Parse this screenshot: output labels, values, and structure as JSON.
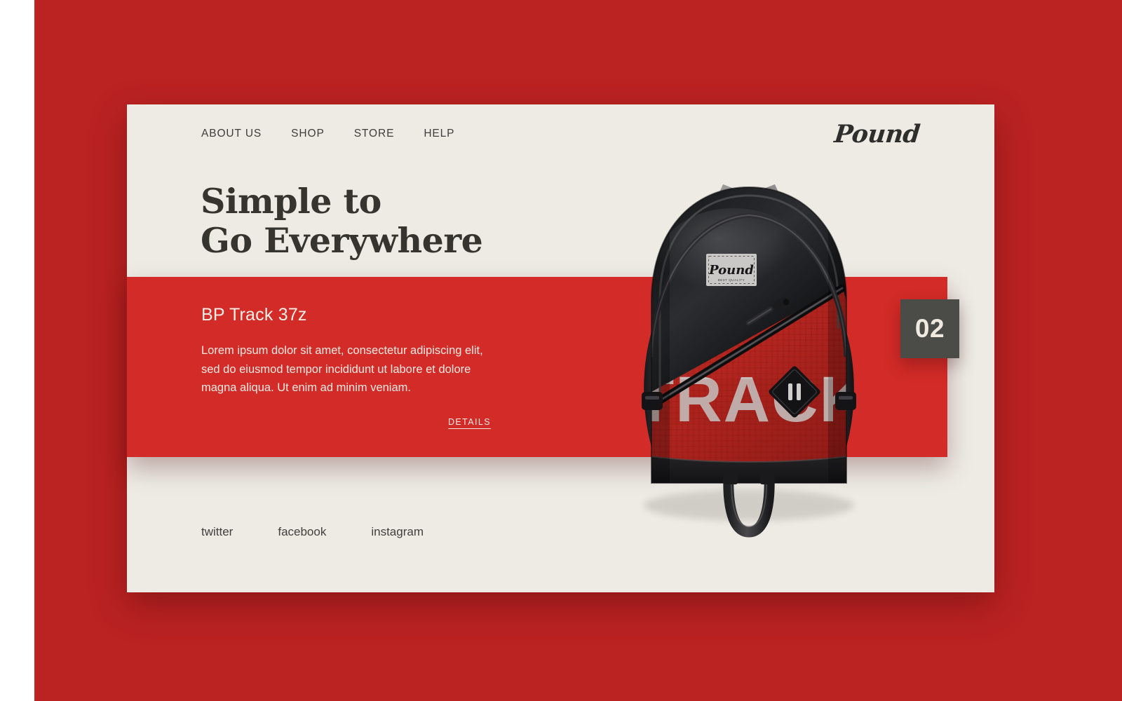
{
  "brand": {
    "logo_text": "Pound"
  },
  "nav": {
    "items": [
      {
        "label": "ABOUT US"
      },
      {
        "label": "SHOP"
      },
      {
        "label": "STORE"
      },
      {
        "label": "HELP"
      }
    ]
  },
  "hero": {
    "headline": "Simple to\nGo Everywhere"
  },
  "product": {
    "title": "BP Track 37z",
    "description": "Lorem ipsum dolor sit amet, consectetur adipiscing elit, sed do eiusmod tempor incididunt ut labore et dolore magna aliqua. Ut enim ad minim veniam.",
    "details_label": "DETAILS",
    "slide_number": "02",
    "bag_front_text": "TRACK",
    "bag_patch_text": "Pound"
  },
  "social": {
    "items": [
      {
        "label": "twitter"
      },
      {
        "label": "facebook"
      },
      {
        "label": "instagram"
      }
    ]
  },
  "colors": {
    "stage_red": "#bb2222",
    "band_red": "#d32b27",
    "card_bg": "#eeebe5",
    "badge_bg": "#4b4b48",
    "text_dark": "#35342f",
    "text_light": "#f2eee8"
  }
}
